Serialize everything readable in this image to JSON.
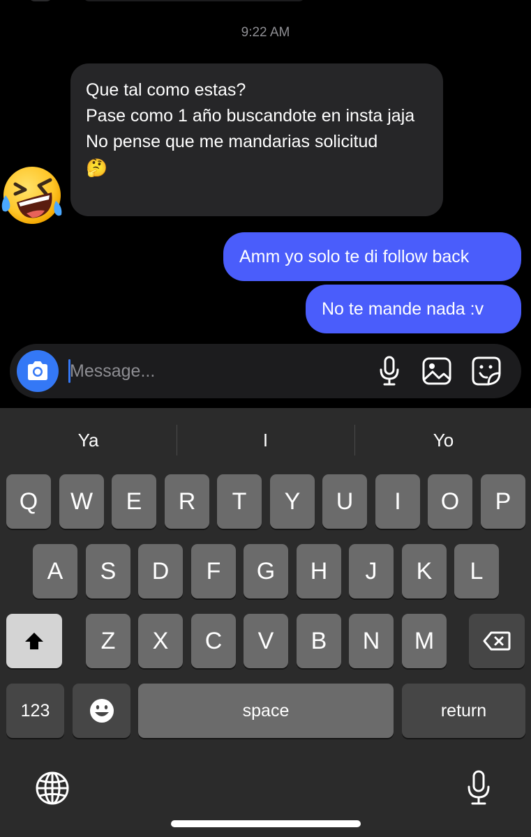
{
  "chat": {
    "timestamp": "9:22 AM",
    "incoming": {
      "lines": [
        "Que tal como estas?",
        "Pase como 1 año buscandote en insta jaja",
        "No pense que me mandarias solicitud"
      ],
      "emoji": "🤔",
      "reaction": "laughing-tears-emoji"
    },
    "outgoing": [
      "Amm yo solo te di follow back",
      "No te mande nada :v"
    ]
  },
  "composer": {
    "placeholder": "Message...",
    "value": "",
    "icons": [
      "camera-icon",
      "microphone-icon",
      "gallery-icon",
      "sticker-icon"
    ]
  },
  "keyboard": {
    "suggestions": [
      "Ya",
      "I",
      "Yo"
    ],
    "row1": [
      "Q",
      "W",
      "E",
      "R",
      "T",
      "Y",
      "U",
      "I",
      "O",
      "P"
    ],
    "row2": [
      "A",
      "S",
      "D",
      "F",
      "G",
      "H",
      "J",
      "K",
      "L"
    ],
    "row3": [
      "Z",
      "X",
      "C",
      "V",
      "B",
      "N",
      "M"
    ],
    "numbers_label": "123",
    "space_label": "space",
    "return_label": "return"
  },
  "colors": {
    "outgoing_bubble": "#4a5dfb",
    "incoming_bubble": "#262628",
    "accent": "#3478f6"
  }
}
